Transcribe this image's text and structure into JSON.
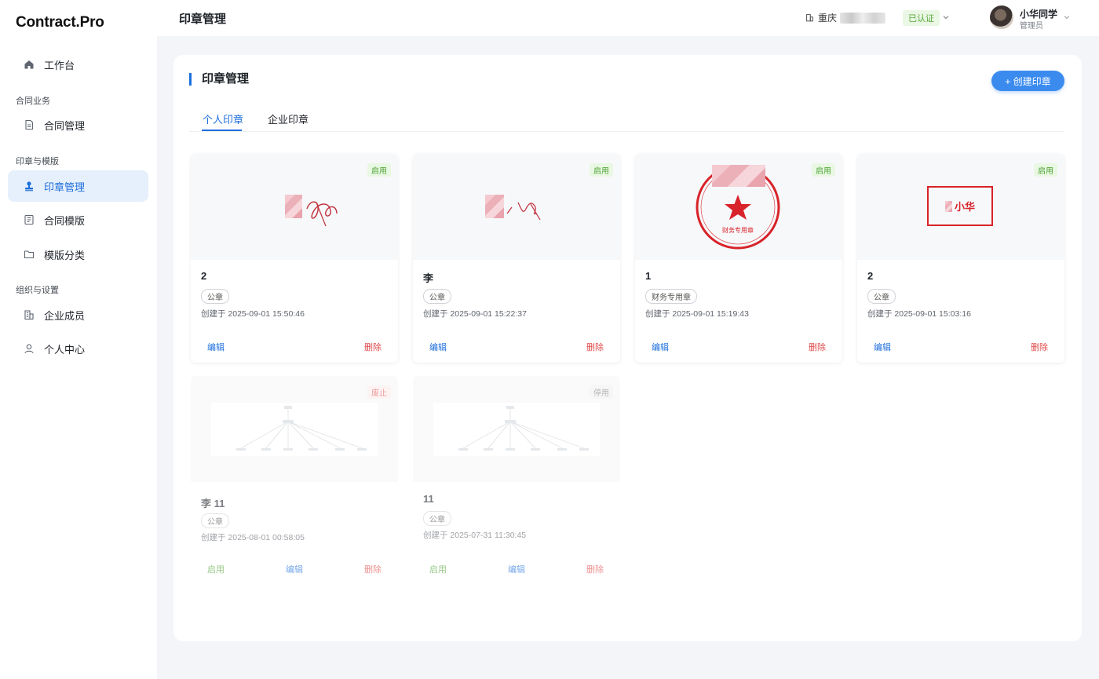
{
  "app": {
    "logo": "Contract.Pro"
  },
  "sidebar": {
    "items": [
      {
        "label": "工作台",
        "icon": "home-icon"
      },
      {
        "label": "合同管理",
        "icon": "document-icon"
      },
      {
        "label": "印章管理",
        "icon": "stamp-icon",
        "active": true
      },
      {
        "label": "合同模版",
        "icon": "template-icon"
      },
      {
        "label": "模版分类",
        "icon": "folder-icon"
      },
      {
        "label": "企业成员",
        "icon": "building-icon"
      },
      {
        "label": "个人中心",
        "icon": "user-icon"
      }
    ],
    "groups": [
      "合同业务",
      "印章与模版",
      "组织与设置"
    ]
  },
  "header": {
    "title": "印章管理",
    "org_name": "重庆",
    "verified": "已认证",
    "user_name": "小华同学",
    "user_role": "管理员"
  },
  "main": {
    "section_title": "印章管理",
    "create_button": "+ 创建印章",
    "tabs": [
      {
        "label": "个人印章",
        "active": true
      },
      {
        "label": "企业印章",
        "active": false
      }
    ]
  },
  "seals": [
    {
      "name": "2",
      "type": "公章",
      "created": "创建于 2025-09-01 15:50:46",
      "status": "启用",
      "status_color": "green",
      "preview": "handwritten-signature",
      "actions": [
        "编辑",
        "删除"
      ]
    },
    {
      "name": "李",
      "type": "公章",
      "created": "创建于 2025-09-01 15:22:37",
      "status": "启用",
      "status_color": "green",
      "preview": "handwritten-signature",
      "actions": [
        "编辑",
        "删除"
      ]
    },
    {
      "name": "1",
      "type": "财务专用章",
      "created": "创建于 2025-09-01 15:19:43",
      "status": "启用",
      "status_color": "green",
      "preview": "round-seal",
      "seal_text": "财务专用章",
      "actions": [
        "编辑",
        "删除"
      ]
    },
    {
      "name": "2",
      "type": "公章",
      "created": "创建于 2025-09-01 15:03:16",
      "status": "启用",
      "status_color": "green",
      "preview": "square-name-seal",
      "seal_text": "小华",
      "actions": [
        "编辑",
        "删除"
      ]
    },
    {
      "name": "李 11",
      "type": "公章",
      "created": "创建于 2025-08-01 00:58:05",
      "status": "废止",
      "status_color": "red",
      "preview": "tree-diagram",
      "actions": [
        "启用",
        "编辑",
        "删除"
      ]
    },
    {
      "name": "11",
      "type": "公章",
      "created": "创建于 2025-07-31 11:30:45",
      "status": "停用",
      "status_color": "gray",
      "preview": "tree-diagram",
      "actions": [
        "启用",
        "编辑",
        "删除"
      ]
    }
  ],
  "colors": {
    "accent": "#1d6fdc",
    "danger": "#e04848",
    "success": "#4fa335",
    "seal_red": "#d8232a"
  }
}
